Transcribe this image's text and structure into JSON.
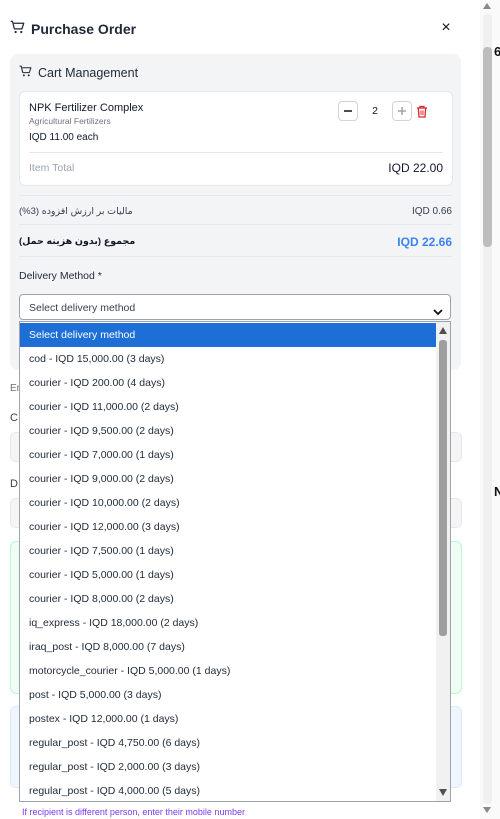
{
  "header": {
    "title": "Purchase Order",
    "close": "×"
  },
  "cart": {
    "title": "Cart Management",
    "item": {
      "name": "NPK Fertilizer Complex",
      "category": "Agricultural Fertilizers",
      "price_each": "IQD 11.00 each",
      "quantity": "2",
      "total_label": "Item Total",
      "total_value": "IQD 22.00"
    },
    "vat_label": "مالیات بر ارزش افزوده (3%)",
    "vat_value": "IQD 0.66",
    "sum_label": "مجموع (بدون هزینه حمل)",
    "sum_value": "IQD 22.66",
    "delivery_label": "Delivery Method *",
    "select_value": "Select delivery method"
  },
  "dropdown": {
    "options": [
      "Select delivery method",
      "cod - IQD 15,000.00 (3 days)",
      "courier - IQD 200.00 (4 days)",
      "courier - IQD 11,000.00 (2 days)",
      "courier - IQD 9,500.00 (2 days)",
      "courier - IQD 7,000.00 (1 days)",
      "courier - IQD 9,000.00 (2 days)",
      "courier - IQD 10,000.00 (2 days)",
      "courier - IQD 12,000.00 (3 days)",
      "courier - IQD 7,500.00 (1 days)",
      "courier - IQD 5,000.00 (1 days)",
      "courier - IQD 8,000.00 (2 days)",
      "iq_express - IQD 18,000.00 (2 days)",
      "iraq_post - IQD 8,000.00 (7 days)",
      "motorcycle_courier - IQD 5,000.00 (1 days)",
      "post - IQD 5,000.00 (3 days)",
      "postex - IQD 12,000.00 (1 days)",
      "regular_post - IQD 4,750.00 (6 days)",
      "regular_post - IQD 2,000.00 (3 days)",
      "regular_post - IQD 4,000.00 (5 days)"
    ]
  },
  "background": {
    "frag_em": "En",
    "frag_c": "C",
    "frag_d": "D",
    "bottom_hint": "If recipient is different person, enter their mobile number",
    "peek_6": "6",
    "peek_n": "N"
  },
  "colors": {
    "accent": "#3b82f6",
    "selected_option": "#1d6fd6",
    "delete": "#dc2626"
  }
}
